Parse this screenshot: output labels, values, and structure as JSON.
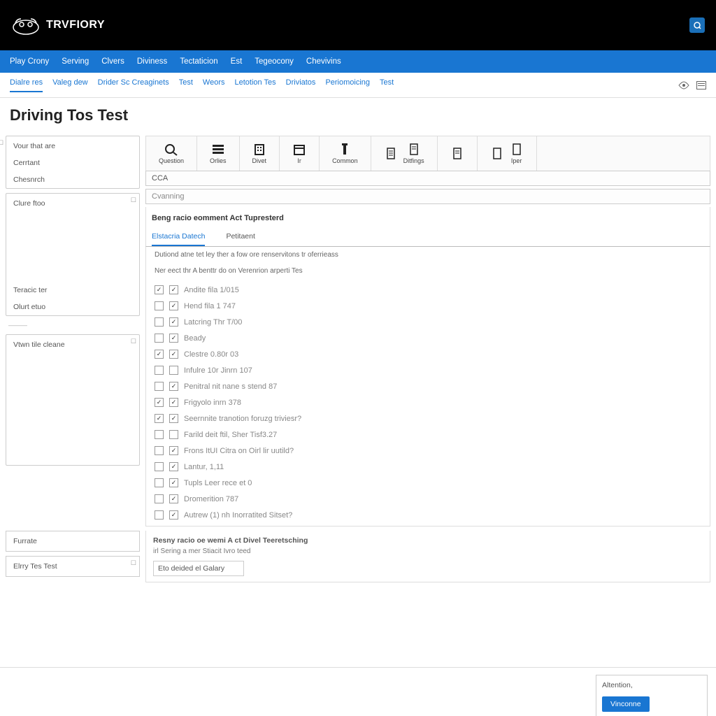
{
  "header": {
    "brand": "TRVFIORY"
  },
  "mainNav": [
    "Play Crony",
    "Serving",
    "Clvers",
    "Diviness",
    "Tectaticion",
    "Est",
    "Tegeocony",
    "Chevivins"
  ],
  "subNav": [
    "Dialre res",
    "Valeg dew",
    "Drider Sc Creaginets",
    "Test",
    "Weors",
    "Letotion Tes",
    "Driviatos",
    "Periomoicing",
    "Test"
  ],
  "subNavActive": 0,
  "pageTitle": "Driving Tos Test",
  "toolbar": [
    {
      "label": "Question",
      "icon": "search"
    },
    {
      "label": "Orlies",
      "icon": "list"
    },
    {
      "label": "Divet",
      "icon": "building"
    },
    {
      "label": "Ir",
      "icon": "calendar"
    },
    {
      "label": "Common",
      "icon": "column"
    },
    {
      "label": "Ditfings",
      "icon": "doc"
    },
    {
      "label": "",
      "icon": "doc"
    },
    {
      "label": "Iper",
      "icon": "doc"
    }
  ],
  "inputCCA": "CCA",
  "inputCvanning": "Cvanning",
  "sectionTitle": "Beng racio eomment Act Tupresterd",
  "tabs2": [
    "Elstacria Datech",
    "Petitaent"
  ],
  "instr1": "Dutiond atne tet ley ther a fow ore renservitons tr oferrieass",
  "instr2": "Ner eect thr A benttr do on Verenrion arperti Tes",
  "questions": [
    {
      "c1": true,
      "c2": true,
      "label": "Andite fila 1/015"
    },
    {
      "c1": false,
      "c2": true,
      "label": "Hend fila 1 747"
    },
    {
      "c1": false,
      "c2": true,
      "label": "Latcring Thr T/00"
    },
    {
      "c1": false,
      "c2": true,
      "label": "Beady"
    },
    {
      "c1": true,
      "c2": true,
      "label": "Clestre 0.80r 03"
    },
    {
      "c1": false,
      "c2": false,
      "label": "Infulre 10r Jinrn 107"
    },
    {
      "c1": false,
      "c2": true,
      "label": "Penitral nit nane s stend 87"
    },
    {
      "c1": true,
      "c2": true,
      "label": "Frigyolo inrn 378"
    },
    {
      "c1": true,
      "c2": true,
      "label": "Seernnite tranotion foruzg triviesr?"
    },
    {
      "c1": false,
      "c2": false,
      "label": "Farild deit ftil, Sher Tisf3.27"
    },
    {
      "c1": false,
      "c2": true,
      "label": "Frons ItUI Citra on Oirl lir uutild?"
    },
    {
      "c1": false,
      "c2": true,
      "label": "Lantur, 1,11"
    },
    {
      "c1": false,
      "c2": true,
      "label": "Tupls Leer rece et 0"
    },
    {
      "c1": false,
      "c2": true,
      "label": "Dromerition 787"
    },
    {
      "c1": false,
      "c2": true,
      "label": "Autrew (1) nh Inorratited Sitset?"
    }
  ],
  "side1": {
    "head": "Vour that are",
    "i1": "Cerrtant",
    "i2": "Chesnrch"
  },
  "side2": {
    "head": "Clure ftoo",
    "b1": "Teracic ter",
    "b2": "Olurt etuo"
  },
  "side3": {
    "head": "Vtwn tile cleane"
  },
  "bottom": {
    "left1": "Furrate",
    "left2": "Elrry Tes Test",
    "r1": "Resny racio oe wemi A ct Divel Teeretsching",
    "r2": "irl Sering a mer Stiacit Ivro teed",
    "r3": "Eto deided el Galary"
  },
  "footer": {
    "msg": "Altention,",
    "btn": "Vinconne"
  }
}
